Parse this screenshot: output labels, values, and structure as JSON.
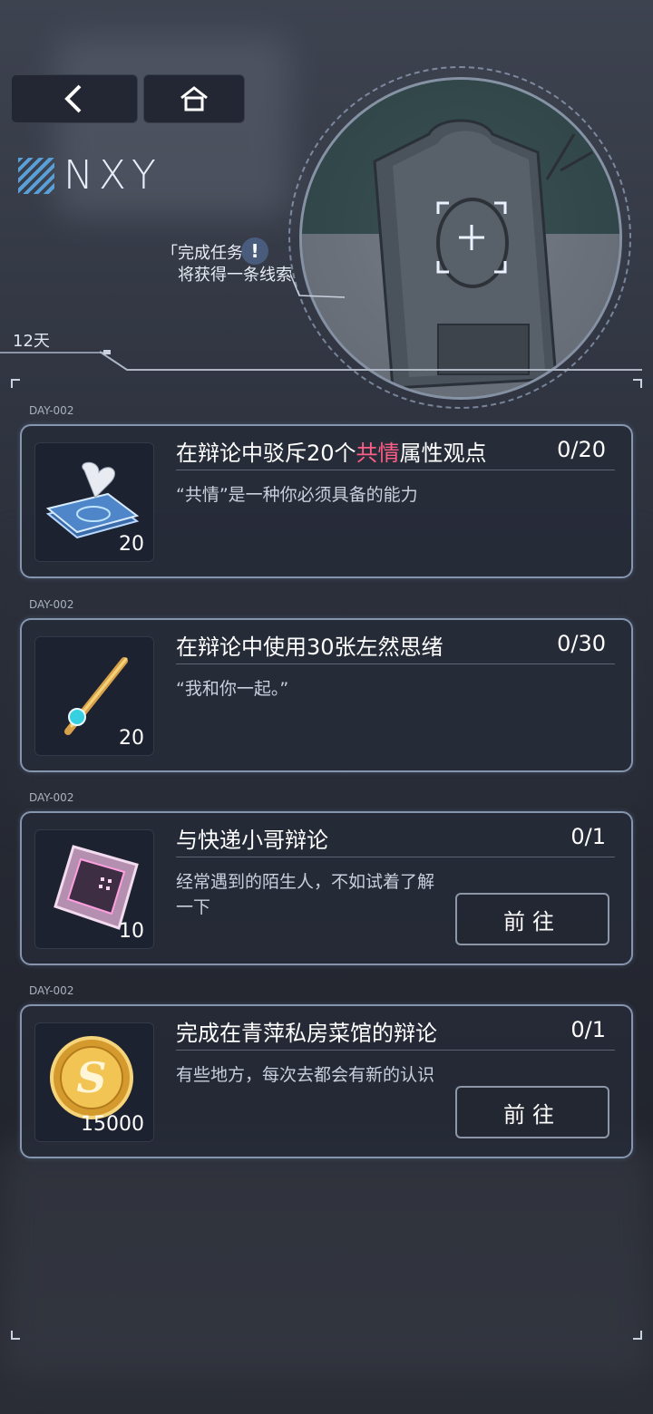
{
  "nav": {
    "back_icon": "chevron-left-icon",
    "home_icon": "home-icon"
  },
  "logo": {
    "text": "NXY"
  },
  "hint": {
    "line1": "「完成任务",
    "line2": "将获得一条线索",
    "alert": "!"
  },
  "days": {
    "label": "12天"
  },
  "quests": [
    {
      "day": "DAY-002",
      "title_pre": "在辩论中驳斥20个",
      "title_hl": "共情",
      "title_post": "属性观点",
      "progress": "0/20",
      "desc": "“共情”是一种你必须具备的能力",
      "reward_count": "20",
      "reward_icon": "card-deck-icon"
    },
    {
      "day": "DAY-002",
      "title": "在辩论中使用30张左然思绪",
      "progress": "0/30",
      "desc": "“我和你一起。”",
      "reward_count": "20",
      "reward_icon": "tie-clip-icon"
    },
    {
      "day": "DAY-002",
      "title": "与快递小哥辩论",
      "progress": "0/1",
      "desc": "经常遇到的陌生人，不如试着了解一下",
      "reward_count": "10",
      "reward_icon": "chip-card-icon",
      "button": "前往"
    },
    {
      "day": "DAY-002",
      "title": "完成在青萍私房菜馆的辩论",
      "progress": "0/1",
      "desc": "有些地方，每次去都会有新的认识",
      "reward_count": "15000",
      "reward_icon": "gold-coin-icon",
      "button": "前往"
    }
  ]
}
